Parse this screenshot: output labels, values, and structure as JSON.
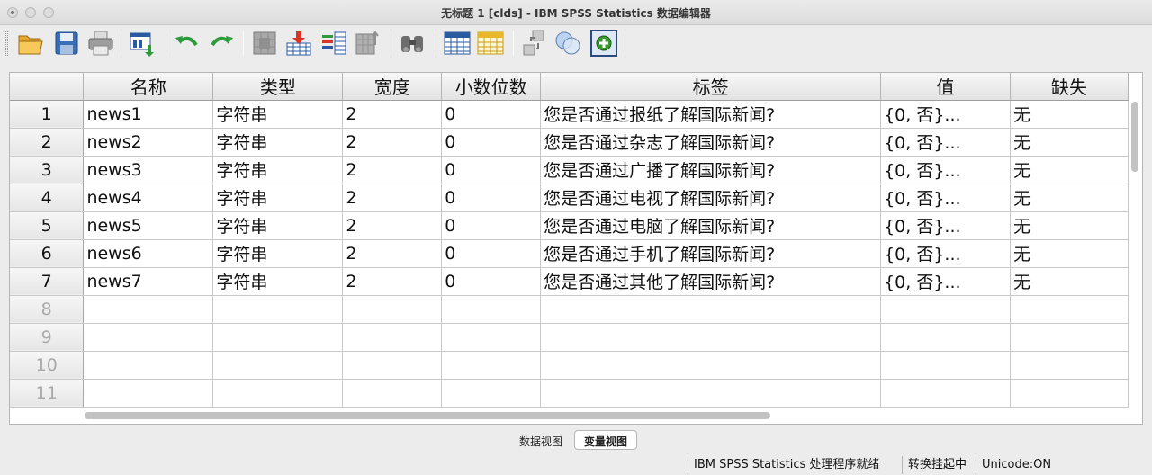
{
  "window": {
    "title": "无标题 1 [clds] - IBM SPSS Statistics 数据编辑器"
  },
  "toolbar": {
    "icons": [
      "open-folder-icon",
      "save-icon",
      "print-icon",
      "recall-dialog-icon",
      "undo-icon",
      "redo-icon",
      "goto-case-icon",
      "goto-variable-icon",
      "variables-icon",
      "run-descriptives-icon",
      "find-icon",
      "insert-cases-icon",
      "insert-variable-icon",
      "split-file-icon",
      "weight-cases-icon",
      "select-cases-icon",
      "value-labels-icon",
      "use-variable-sets-icon"
    ]
  },
  "grid": {
    "columns": [
      "名称",
      "类型",
      "宽度",
      "小数位数",
      "标签",
      "值",
      "缺失"
    ],
    "rows": [
      {
        "num": "1",
        "name": "news1",
        "type": "字符串",
        "width": "2",
        "decimals": "0",
        "label": "您是否通过报纸了解国际新闻?",
        "values": "{0, 否}...",
        "missing": "无"
      },
      {
        "num": "2",
        "name": "news2",
        "type": "字符串",
        "width": "2",
        "decimals": "0",
        "label": "您是否通过杂志了解国际新闻?",
        "values": "{0, 否}...",
        "missing": "无"
      },
      {
        "num": "3",
        "name": "news3",
        "type": "字符串",
        "width": "2",
        "decimals": "0",
        "label": "您是否通过广播了解国际新闻?",
        "values": "{0, 否}...",
        "missing": "无"
      },
      {
        "num": "4",
        "name": "news4",
        "type": "字符串",
        "width": "2",
        "decimals": "0",
        "label": "您是否通过电视了解国际新闻?",
        "values": "{0, 否}...",
        "missing": "无"
      },
      {
        "num": "5",
        "name": "news5",
        "type": "字符串",
        "width": "2",
        "decimals": "0",
        "label": "您是否通过电脑了解国际新闻?",
        "values": "{0, 否}...",
        "missing": "无"
      },
      {
        "num": "6",
        "name": "news6",
        "type": "字符串",
        "width": "2",
        "decimals": "0",
        "label": "您是否通过手机了解国际新闻?",
        "values": "{0, 否}...",
        "missing": "无"
      },
      {
        "num": "7",
        "name": "news7",
        "type": "字符串",
        "width": "2",
        "decimals": "0",
        "label": "您是否通过其他了解国际新闻?",
        "values": "{0, 否}...",
        "missing": "无"
      }
    ],
    "empty_rows": [
      "8",
      "9",
      "10",
      "11"
    ]
  },
  "tabs": {
    "data_view": "数据视图",
    "variable_view": "变量视图"
  },
  "status": {
    "processor": "IBM SPSS Statistics 处理程序就绪",
    "transform": "转换挂起中",
    "unicode": "Unicode:ON"
  }
}
